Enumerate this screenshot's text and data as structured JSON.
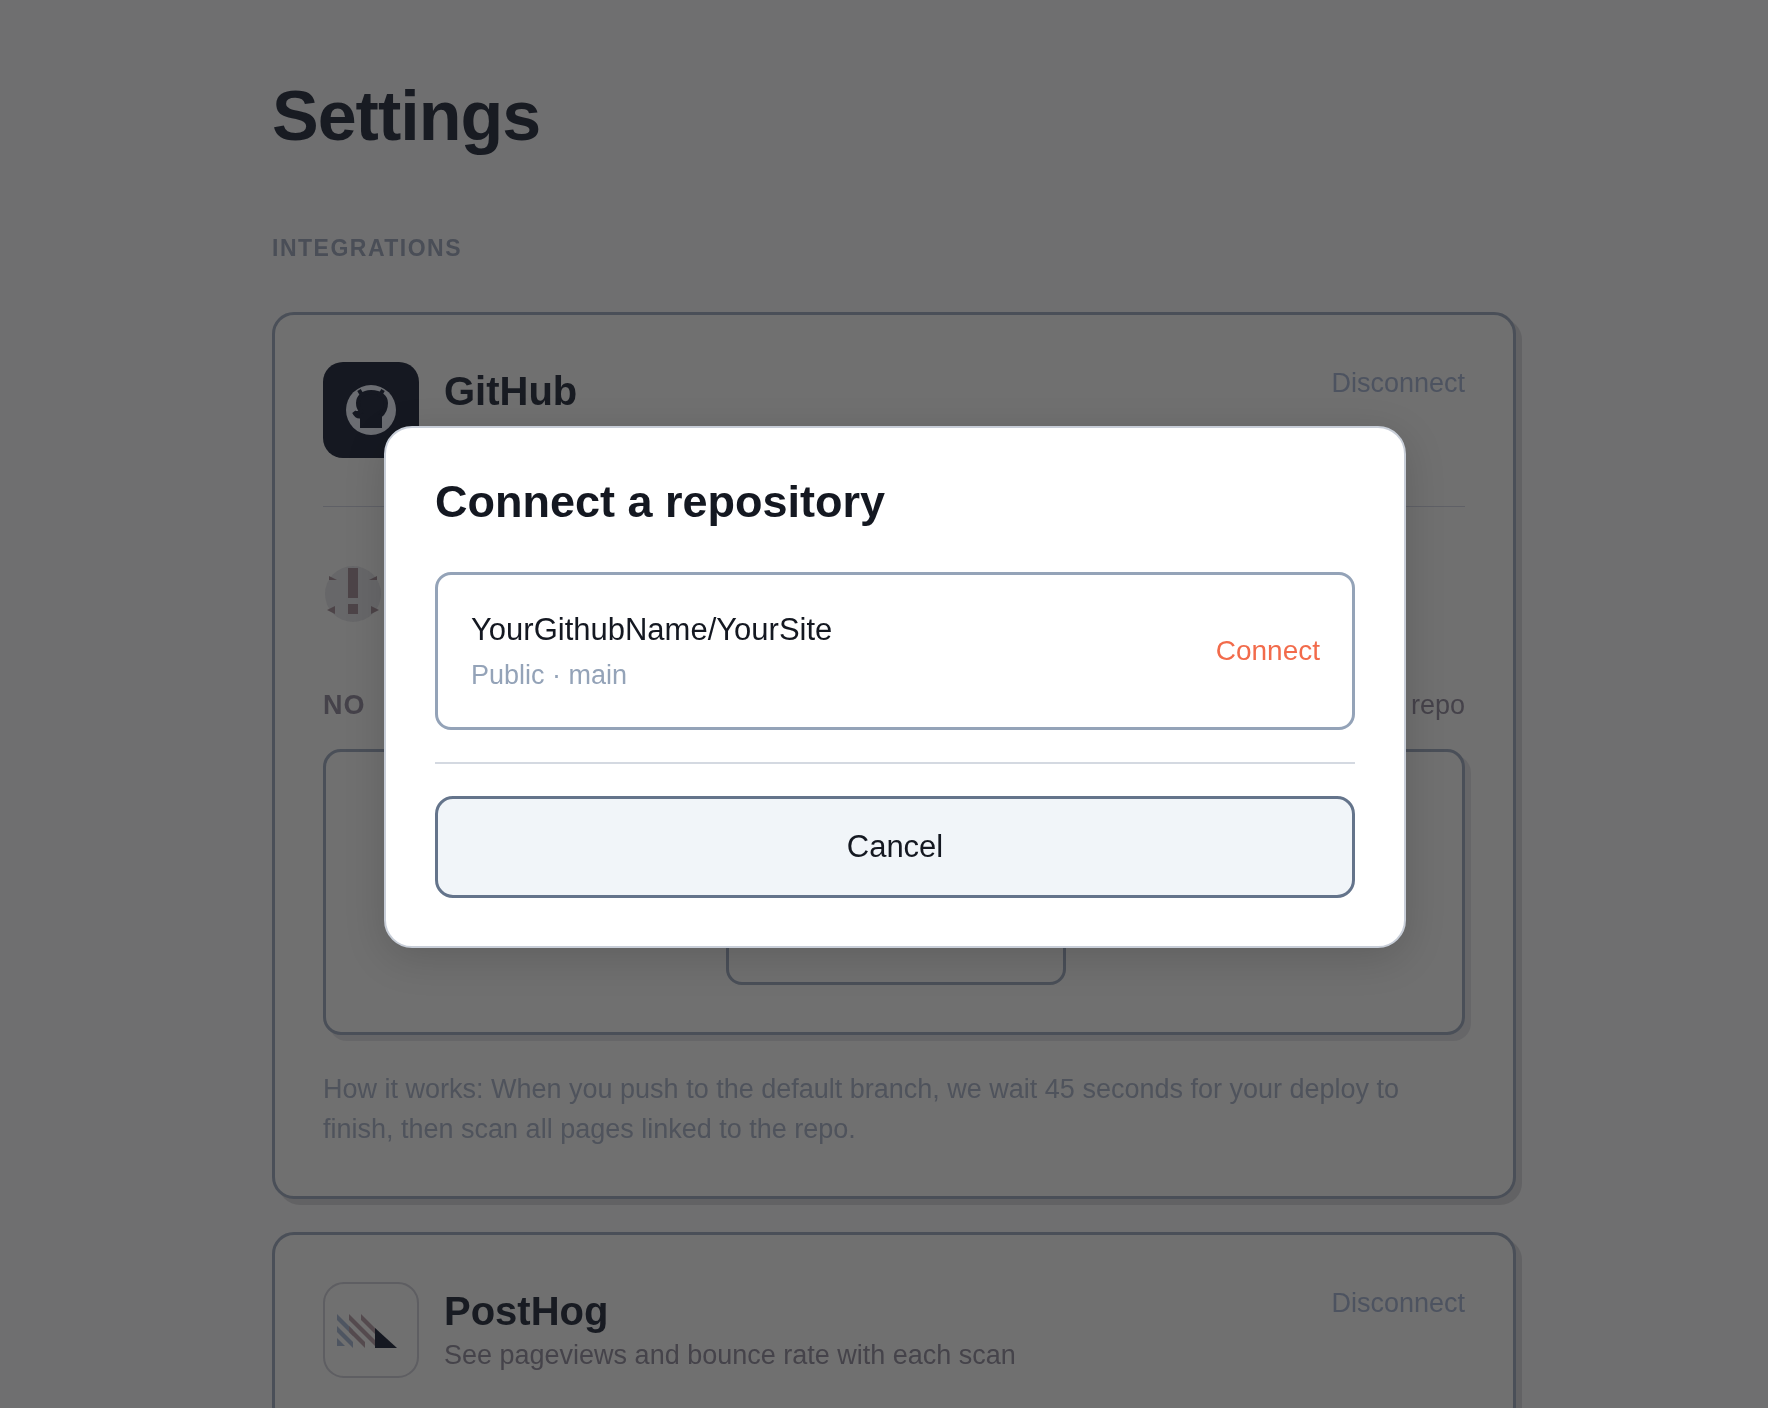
{
  "page": {
    "title": "Settings"
  },
  "section_label": "INTEGRATIONS",
  "integrations": [
    {
      "kind": "github",
      "name": "GitHub",
      "action": "Disconnect",
      "list_label": "NO",
      "list_link": "repo",
      "note": "How it works: When you push to the default branch, we wait 45 seconds for your deploy to finish, then scan all pages linked to the repo."
    },
    {
      "kind": "posthog",
      "name": "PostHog",
      "description": "See pageviews and bounce rate with each scan",
      "action": "Disconnect"
    }
  ],
  "dialog": {
    "title": "Connect a repository",
    "repositories": [
      {
        "name": "YourGithubName/YourSite",
        "meta": "Public · main",
        "action": "Connect"
      }
    ],
    "buttons": [
      "Cancel"
    ]
  }
}
